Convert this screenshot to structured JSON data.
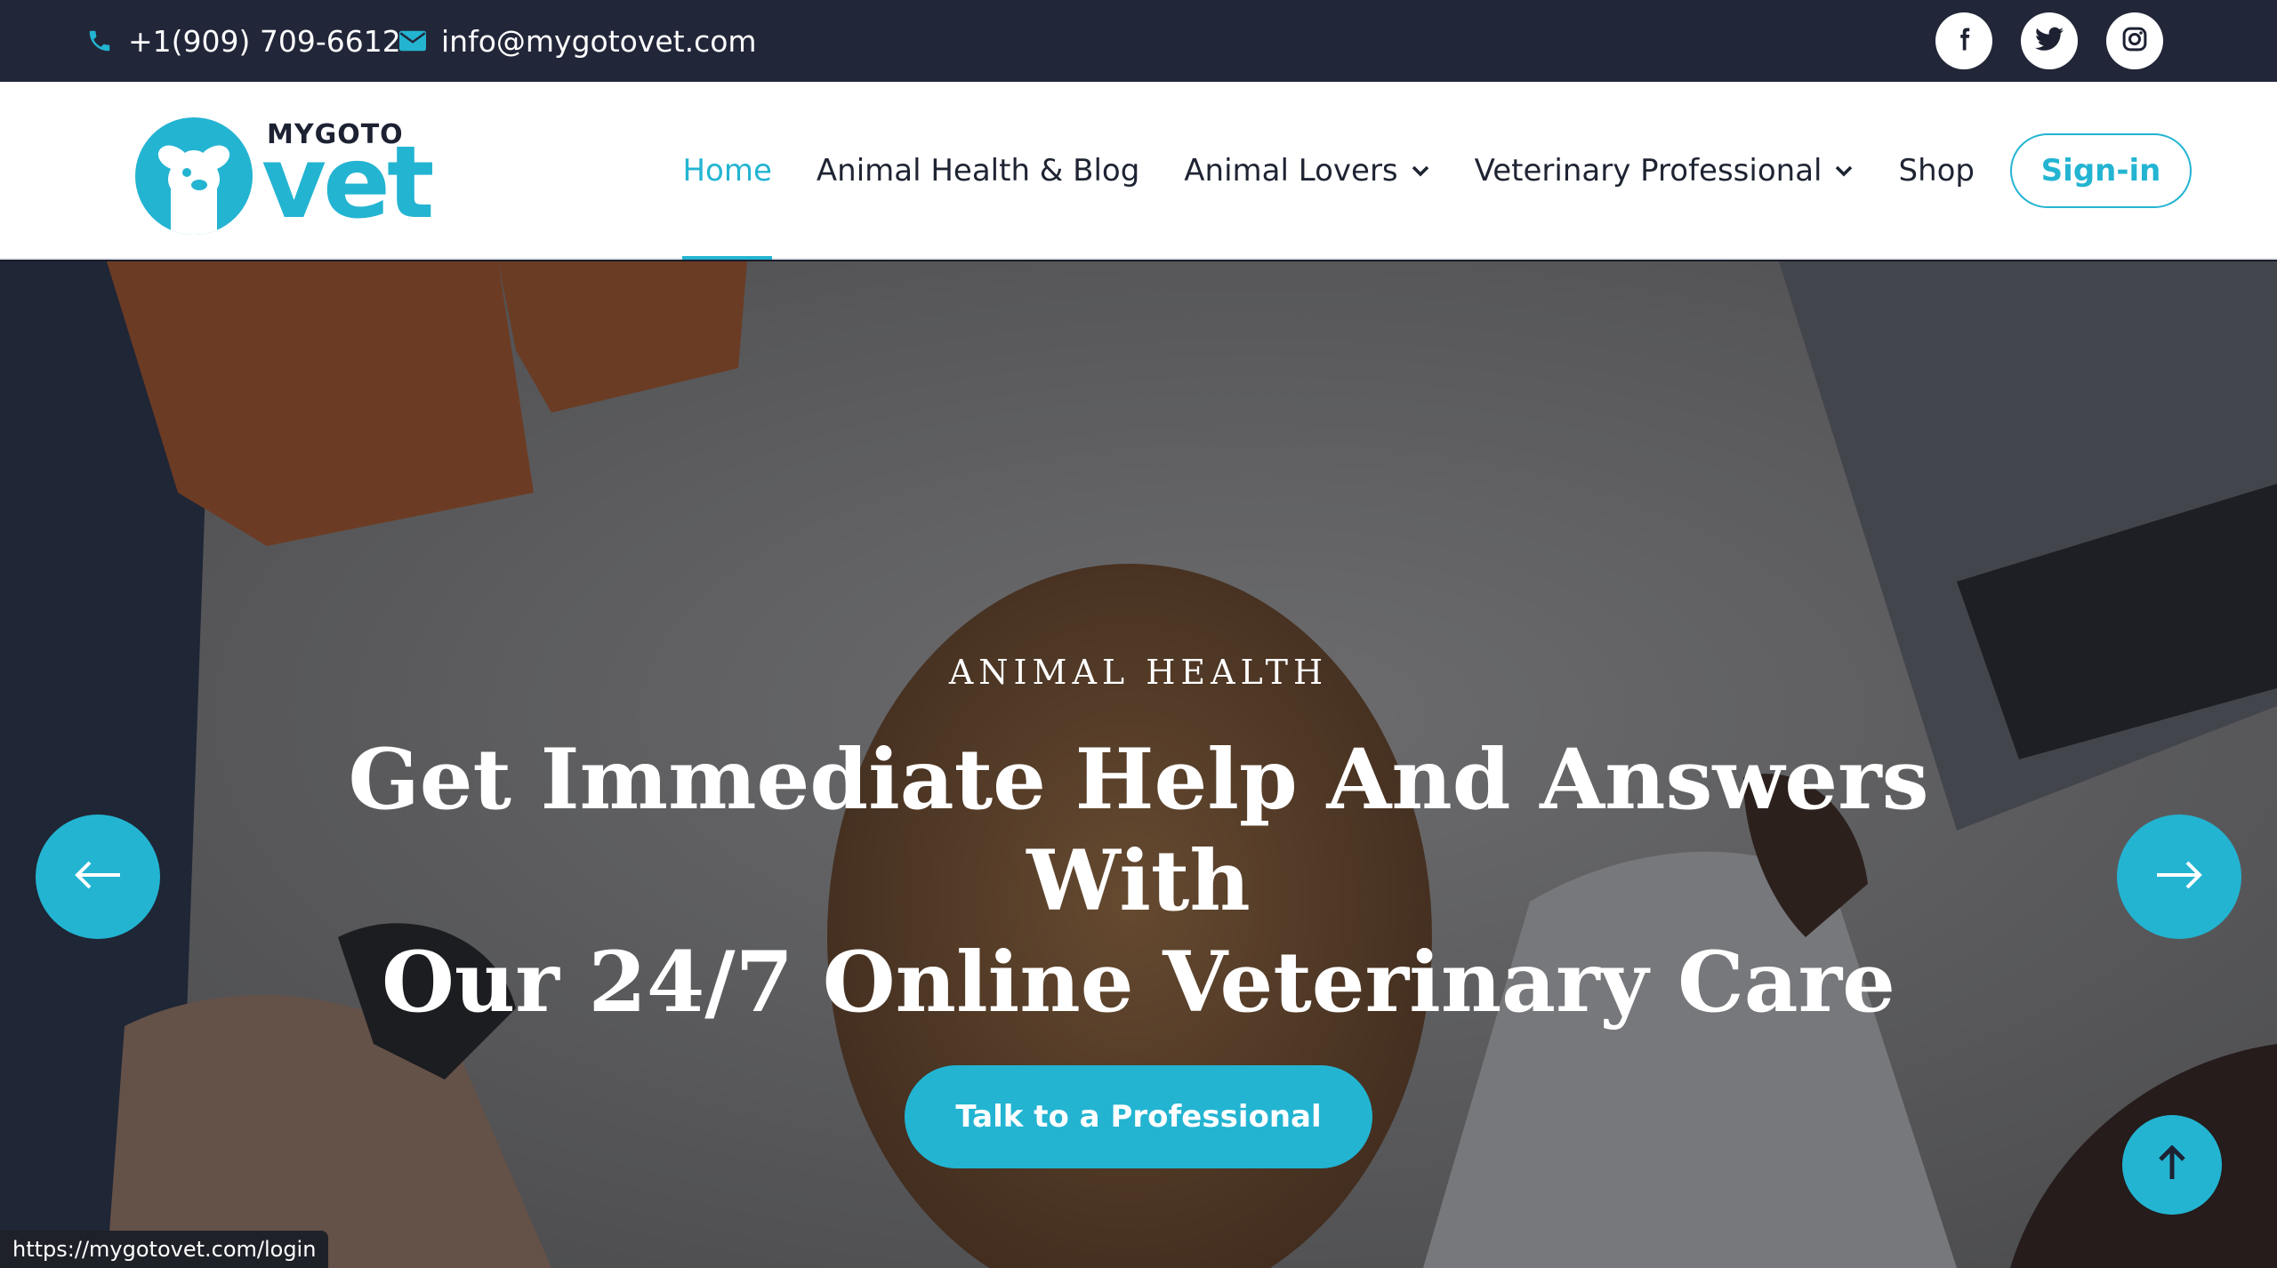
{
  "topbar": {
    "phone": "+1(909) 709-6612",
    "email": "info@mygotovet.com",
    "socials": [
      "facebook-icon",
      "twitter-icon",
      "instagram-icon"
    ]
  },
  "logo": {
    "small_text": "MYGOTO",
    "big_text": "vet"
  },
  "nav": {
    "items": [
      {
        "label": "Home",
        "active": true
      },
      {
        "label": "Animal Health & Blog"
      },
      {
        "label": "Animal Lovers",
        "dropdown": true
      },
      {
        "label": "Veterinary Professional",
        "dropdown": true
      },
      {
        "label": "Shop"
      }
    ],
    "signin_label": "Sign-in"
  },
  "hero": {
    "eyebrow": "ANIMAL HEALTH",
    "headline_line1": "Get Immediate Help And Answers With",
    "headline_line2": "Our 24/7 Online Veterinary Care",
    "cta_label": "Talk to a Professional"
  },
  "status_url": "https://mygotovet.com/login",
  "colors": {
    "accent": "#23b4d2",
    "topbar_bg": "#222639",
    "text_dark": "#1f2433"
  }
}
